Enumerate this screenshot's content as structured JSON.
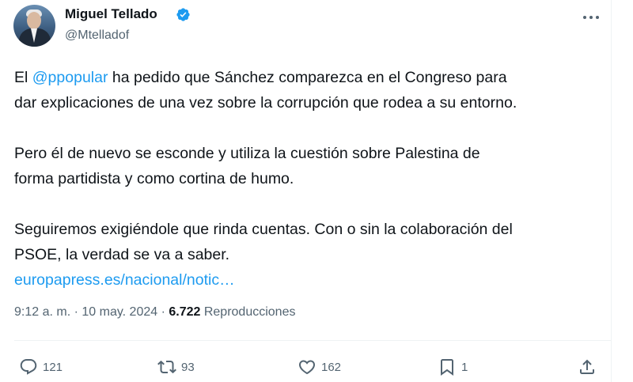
{
  "tweet": {
    "author_name": "Miguel Tellado",
    "author_handle": "@Mtelladof",
    "body": {
      "p1_prefix": "El ",
      "p1_mention": "@ppopular",
      "p1_rest_line1": " ha pedido que Sánchez comparezca en el Congreso para",
      "p1_line2": "dar explicaciones de una vez sobre la corrupción que rodea a su entorno.",
      "p2_line1": "Pero él de nuevo se esconde y utiliza la cuestión sobre Palestina de",
      "p2_line2": "forma partidista y como cortina de humo.",
      "p3_line1": "Seguiremos exigiéndole que rinda cuentas. Con o sin la colaboración del",
      "p3_line2": "PSOE, la verdad se va a saber.",
      "link": "europapress.es/nacional/notic…"
    },
    "meta": {
      "time": "9:12 a. m.",
      "separator": " · ",
      "date": "10 may. 2024",
      "views_count": "6.722",
      "views_label": " Reproducciones"
    },
    "actions": {
      "replies": "121",
      "reposts": "93",
      "likes": "162",
      "bookmarks": "1"
    },
    "colors": {
      "accent": "#1d9bf0",
      "text": "#0f1419",
      "secondary": "#536471"
    },
    "icons": [
      "verified-badge-icon",
      "more-icon",
      "reply-icon",
      "repost-icon",
      "like-icon",
      "bookmark-icon",
      "share-icon"
    ]
  }
}
